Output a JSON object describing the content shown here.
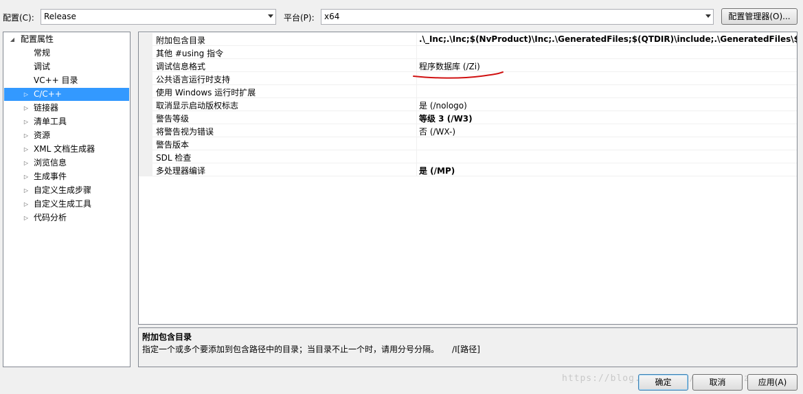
{
  "toolbar": {
    "config_label": "配置(C):",
    "config_value": "Release",
    "platform_label": "平台(P):",
    "platform_value": "x64",
    "config_manager_button": "配置管理器(O)..."
  },
  "tree": {
    "items": [
      {
        "label": "配置属性",
        "expander": "◢"
      },
      {
        "label": "常规",
        "expander": ""
      },
      {
        "label": "调试",
        "expander": ""
      },
      {
        "label": "VC++ 目录",
        "expander": ""
      },
      {
        "label": "C/C++",
        "expander": "▷"
      },
      {
        "label": "链接器",
        "expander": "▷"
      },
      {
        "label": "清单工具",
        "expander": "▷"
      },
      {
        "label": "资源",
        "expander": "▷"
      },
      {
        "label": "XML 文档生成器",
        "expander": "▷"
      },
      {
        "label": "浏览信息",
        "expander": "▷"
      },
      {
        "label": "生成事件",
        "expander": "▷"
      },
      {
        "label": "自定义生成步骤",
        "expander": "▷"
      },
      {
        "label": "自定义生成工具",
        "expander": "▷"
      },
      {
        "label": "代码分析",
        "expander": "▷"
      }
    ]
  },
  "grid": {
    "rows": [
      {
        "name": "附加包含目录",
        "value": ".\\_Inc;.\\Inc;$(NvProduct)\\Inc;.\\GeneratedFiles;$(QTDIR)\\include;.\\GeneratedFiles\\$(Configu"
      },
      {
        "name": "其他 #using 指令",
        "value": ""
      },
      {
        "name": "调试信息格式",
        "value": "程序数据库 (/Zi)"
      },
      {
        "name": "公共语言运行时支持",
        "value": ""
      },
      {
        "name": "使用 Windows 运行时扩展",
        "value": ""
      },
      {
        "name": "取消显示启动版权标志",
        "value": "是 (/nologo)"
      },
      {
        "name": "警告等级",
        "value": "等级 3 (/W3)"
      },
      {
        "name": "将警告视为错误",
        "value": "否 (/WX-)"
      },
      {
        "name": "警告版本",
        "value": ""
      },
      {
        "name": "SDL 检查",
        "value": ""
      },
      {
        "name": "多处理器编译",
        "value": "是 (/MP)"
      }
    ]
  },
  "description": {
    "title": "附加包含目录",
    "text": "指定一个或多个要添加到包含路径中的目录；当目录不止一个时，请用分号分隔。",
    "switch": "/I[路径]"
  },
  "buttons": {
    "ok": "确定",
    "cancel": "取消",
    "apply": "应用(A)"
  },
  "watermark": "https://blog.csdn.net/yangzhenzhen"
}
